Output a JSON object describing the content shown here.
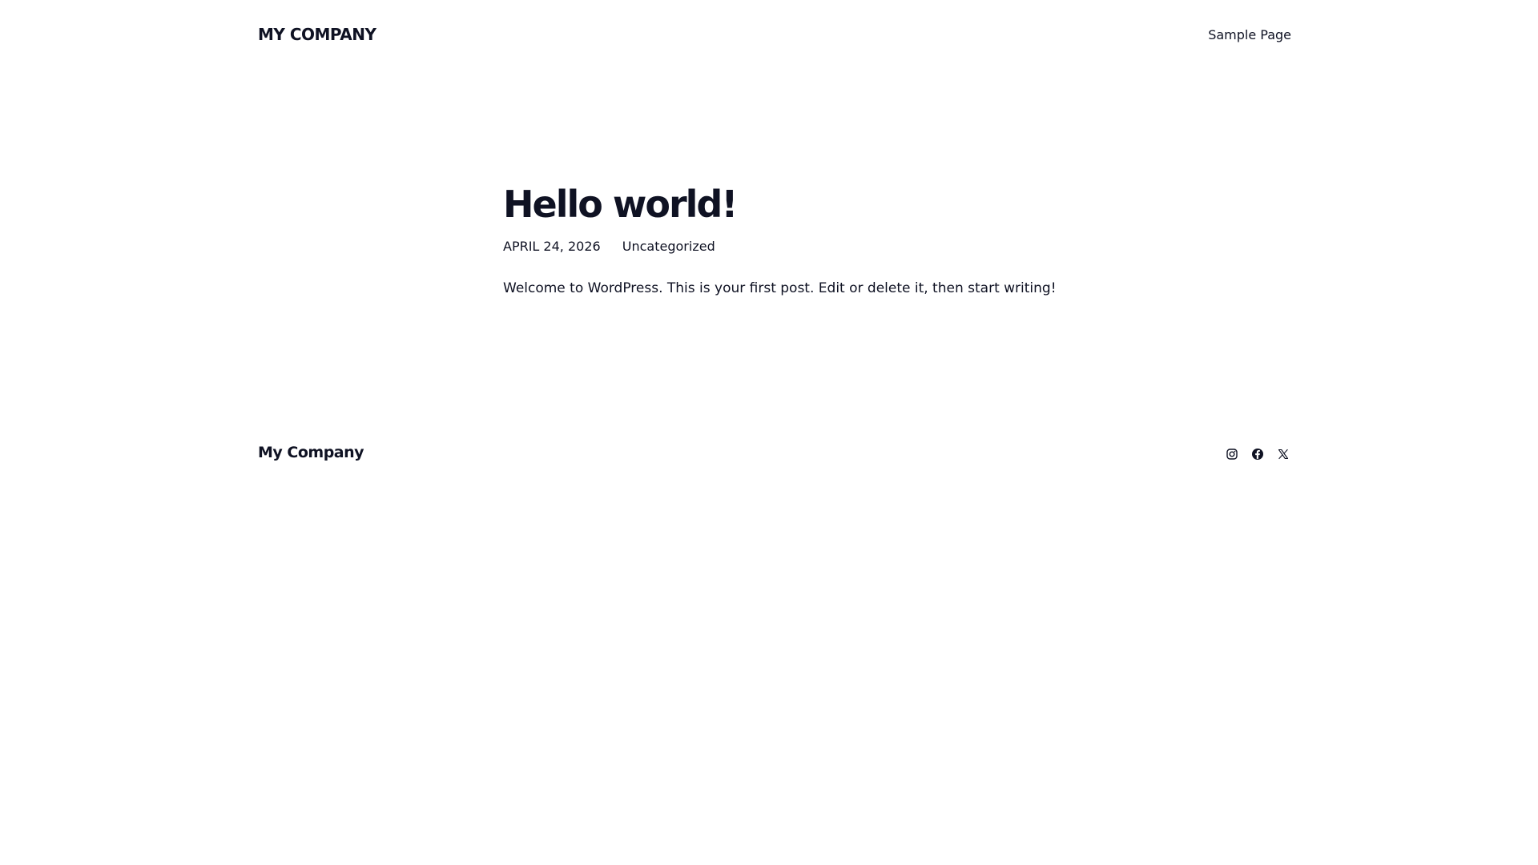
{
  "header": {
    "site_title": "MY COMPANY",
    "nav_items": [
      {
        "label": "Sample Page"
      }
    ]
  },
  "post": {
    "title": "Hello world!",
    "date": "APRIL 24, 2026",
    "category": "Uncategorized",
    "content": "Welcome to WordPress. This is your first post. Edit or delete it, then start writing!"
  },
  "footer": {
    "site_title": "My Company",
    "social_icons": [
      "instagram-icon",
      "facebook-icon",
      "x-icon"
    ]
  },
  "colors": {
    "background": "#ffffff",
    "text": "#0f1223"
  }
}
